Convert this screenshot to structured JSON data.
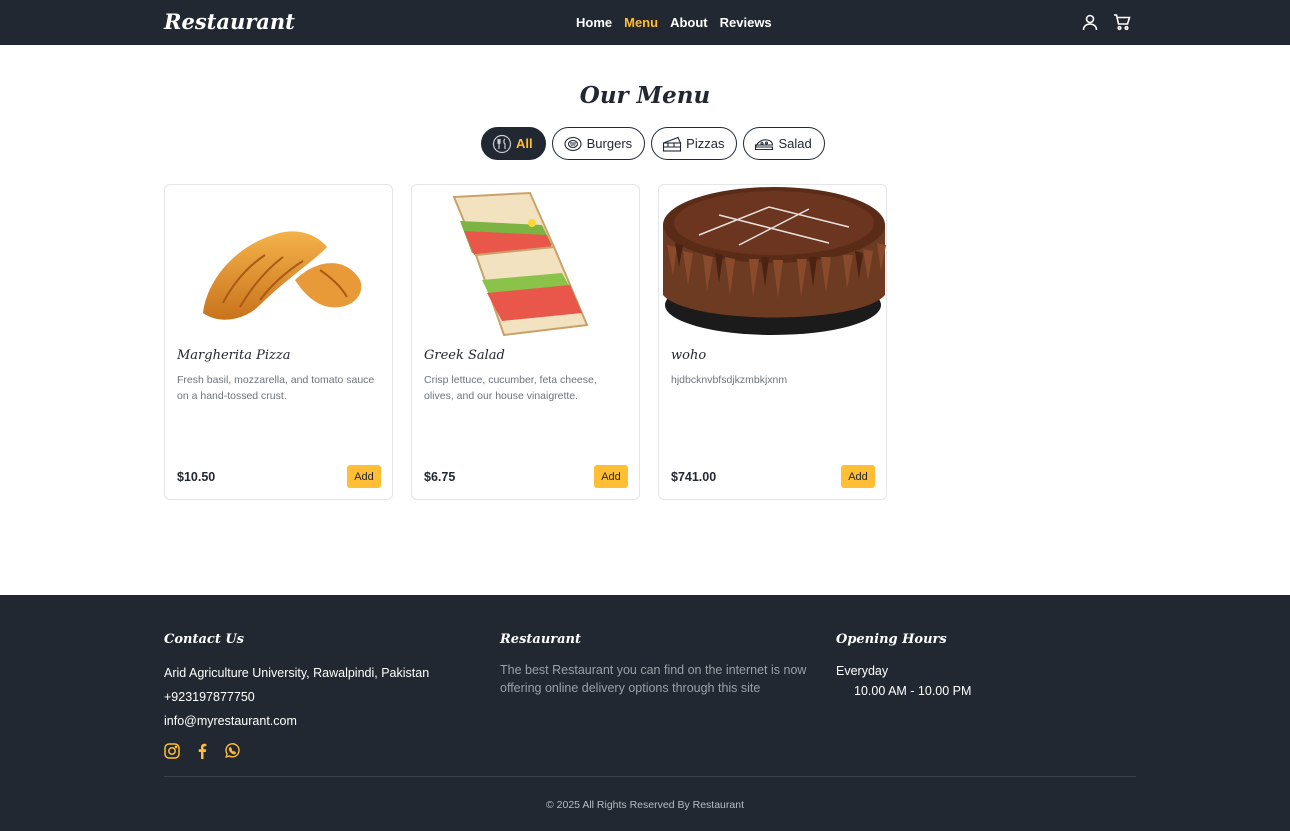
{
  "brand": "Restaurant",
  "nav": {
    "links": [
      "Home",
      "Menu",
      "About",
      "Reviews"
    ],
    "active": "Menu",
    "icons": [
      "user-icon",
      "cart-icon"
    ]
  },
  "menu": {
    "title": "Our Menu",
    "filters": [
      {
        "label": "All",
        "icon": "all-food-icon",
        "active": true
      },
      {
        "label": "Burgers",
        "icon": "burger-icon",
        "active": false
      },
      {
        "label": "Pizzas",
        "icon": "pizza-icon",
        "active": false
      },
      {
        "label": "Salad",
        "icon": "salad-icon",
        "active": false
      }
    ],
    "items": [
      {
        "name": "Margherita Pizza",
        "description": "Fresh basil, mozzarella, and tomato sauce on a hand-tossed crust.",
        "price": "$10.50",
        "button": "Add",
        "image": "croissant-image"
      },
      {
        "name": "Greek Salad",
        "description": "Crisp lettuce, cucumber, feta cheese, olives, and our house vinaigrette.",
        "price": "$6.75",
        "button": "Add",
        "image": "sandwich-image"
      },
      {
        "name": "woho",
        "description": "hjdbcknvbfsdjkzmbkjxnm",
        "price": "$741.00",
        "button": "Add",
        "image": "chocolate-cake-image"
      }
    ]
  },
  "footer": {
    "contact": {
      "title": "Contact Us",
      "address": "Arid Agriculture University, Rawalpindi, Pakistan",
      "phone": "+923197877750",
      "email": "info@myrestaurant.com",
      "social": [
        "instagram-icon",
        "facebook-icon",
        "whatsapp-icon"
      ]
    },
    "about": {
      "title": "Restaurant",
      "text": "The best Restaurant you can find on the internet is now offering online delivery options through this site"
    },
    "hours": {
      "title": "Opening Hours",
      "day": "Everyday",
      "time": "10.00 AM - 10.00 PM"
    },
    "copyright": "© 2025 All Rights Reserved By Restaurant"
  },
  "colors": {
    "dark": "#222831",
    "accent": "#ffbe33",
    "muted": "#6c757d"
  }
}
